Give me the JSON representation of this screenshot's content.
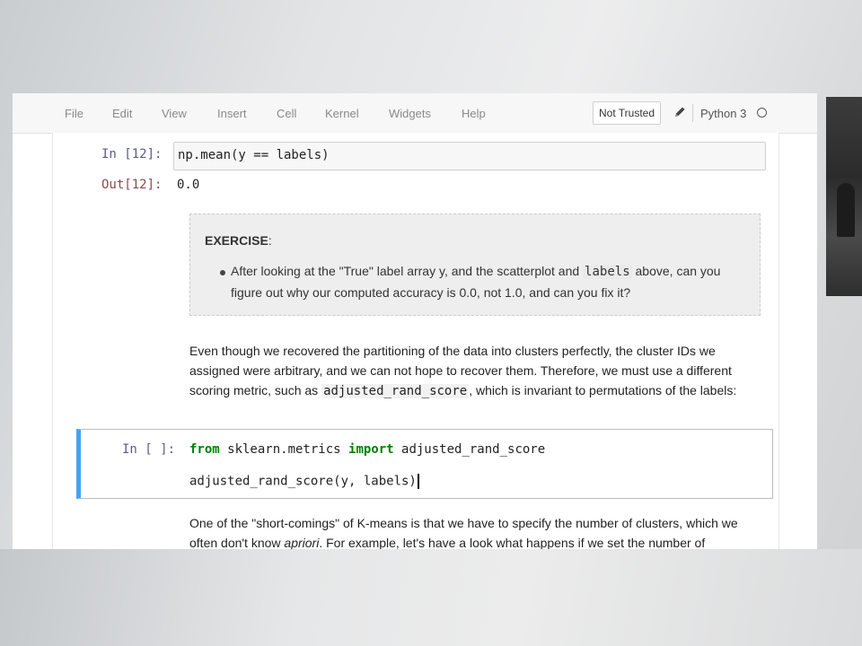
{
  "menubar": {
    "items": [
      "File",
      "Edit",
      "View",
      "Insert",
      "Cell",
      "Kernel",
      "Widgets",
      "Help"
    ],
    "trust_label": "Not Trusted",
    "kernel_name": "Python 3"
  },
  "cells": {
    "c12": {
      "in_prompt": "In [12]:",
      "code": "np.mean(y == labels)",
      "out_prompt": "Out[12]:",
      "output": "0.0"
    },
    "exercise": {
      "title": "EXERCISE",
      "title_suffix": ":",
      "text_before": "After looking at the \"True\" label array y, and the scatterplot and ",
      "code": "labels",
      "text_after": " above, can you figure out why our computed accuracy is 0.0, not 1.0, and can you fix it?"
    },
    "paragraph1": {
      "text_before": "Even though we recovered the partitioning of the data into clusters perfectly, the cluster IDs we assigned were arbitrary, and we can not hope to recover them. Therefore, we must use a different scoring metric, such as ",
      "code": "adjusted_rand_score",
      "text_after": ", which is invariant to permutations of the labels:"
    },
    "active": {
      "in_prompt": "In [ ]:",
      "line1_kw1": "from",
      "line1_mod": " sklearn.metrics ",
      "line1_kw2": "import",
      "line1_name": " adjusted_rand_score",
      "line2": "adjusted_rand_score(y, labels)"
    },
    "paragraph2": {
      "text_before": "One of the \"short-comings\" of K-means is that we have to specify the number of clusters, which we often don't know ",
      "emph": "apriori",
      "text_after": ". For example, let's have a look what happens if we set the number of"
    }
  },
  "colors": {
    "selected_cell_border": "#42a5f5",
    "keyword": "#008000"
  },
  "icons": [
    "pencil-icon",
    "kernel-idle-icon"
  ]
}
